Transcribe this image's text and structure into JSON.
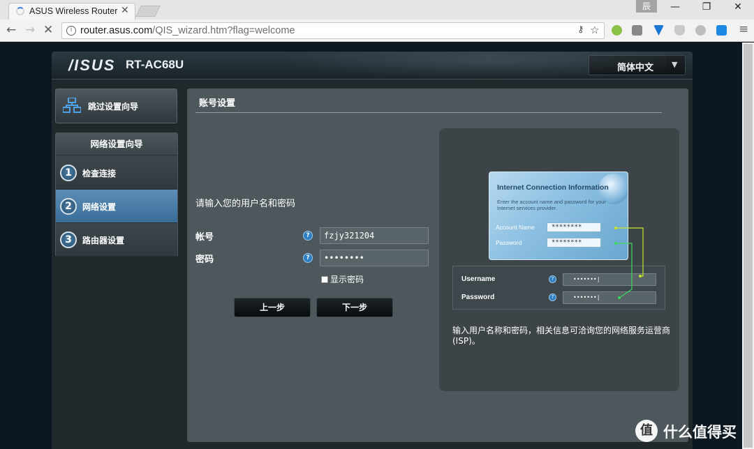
{
  "browser": {
    "tab_title": "ASUS Wireless Router R",
    "tab_close": "✕",
    "profile_label": "辰",
    "win_min": "—",
    "win_max": "❐",
    "win_close": "✕",
    "url_host": "router.asus.com",
    "url_path": "/QIS_wizard.htm?flag=welcome",
    "back": "←",
    "forward": "→",
    "stop": "✕",
    "extensions": [
      "circle-ext-icon",
      "mail-ext-icon",
      "v-ext-icon",
      "shield-ext-icon",
      "cloud-ext-icon",
      "s-ext-icon",
      "menu-icon"
    ]
  },
  "router": {
    "brand": "/ISUS",
    "model": "RT-AC68U",
    "language": "简体中文"
  },
  "sidebar": {
    "skip_label": "跳过设置向导",
    "wizard_title": "网络设置向导",
    "steps": [
      {
        "num": "1",
        "label": "检查连接"
      },
      {
        "num": "2",
        "label": "网络设置"
      },
      {
        "num": "3",
        "label": "路由器设置"
      }
    ]
  },
  "content": {
    "title": "账号设置",
    "prompt": "请输入您的用户名和密码",
    "account_label": "帐号",
    "account_value": "fzjy321204",
    "password_label": "密码",
    "password_value": "••••••••",
    "help_glyph": "?",
    "show_password": "显示密码",
    "prev_button": "上一步",
    "next_button": "下一步"
  },
  "reference": {
    "card_title": "Internet Connection Information",
    "card_desc": "Enter the account name and password for your Internet services provider.",
    "card_account_label": "Account Name",
    "card_account_value": "********",
    "card_password_label": "Password",
    "card_password_value": "********",
    "mini_username_label": "Username",
    "mini_username_value": "•••••••|",
    "mini_password_label": "Password",
    "mini_password_value": "•••••••|",
    "note": "输入用户名称和密码，相关信息可洽询您的网络服务运营商 (ISP)。"
  },
  "watermark": {
    "logo": "值",
    "text": "什么值得买"
  },
  "colors": {
    "accent": "#3a6d98",
    "connector": "#c8e628"
  }
}
